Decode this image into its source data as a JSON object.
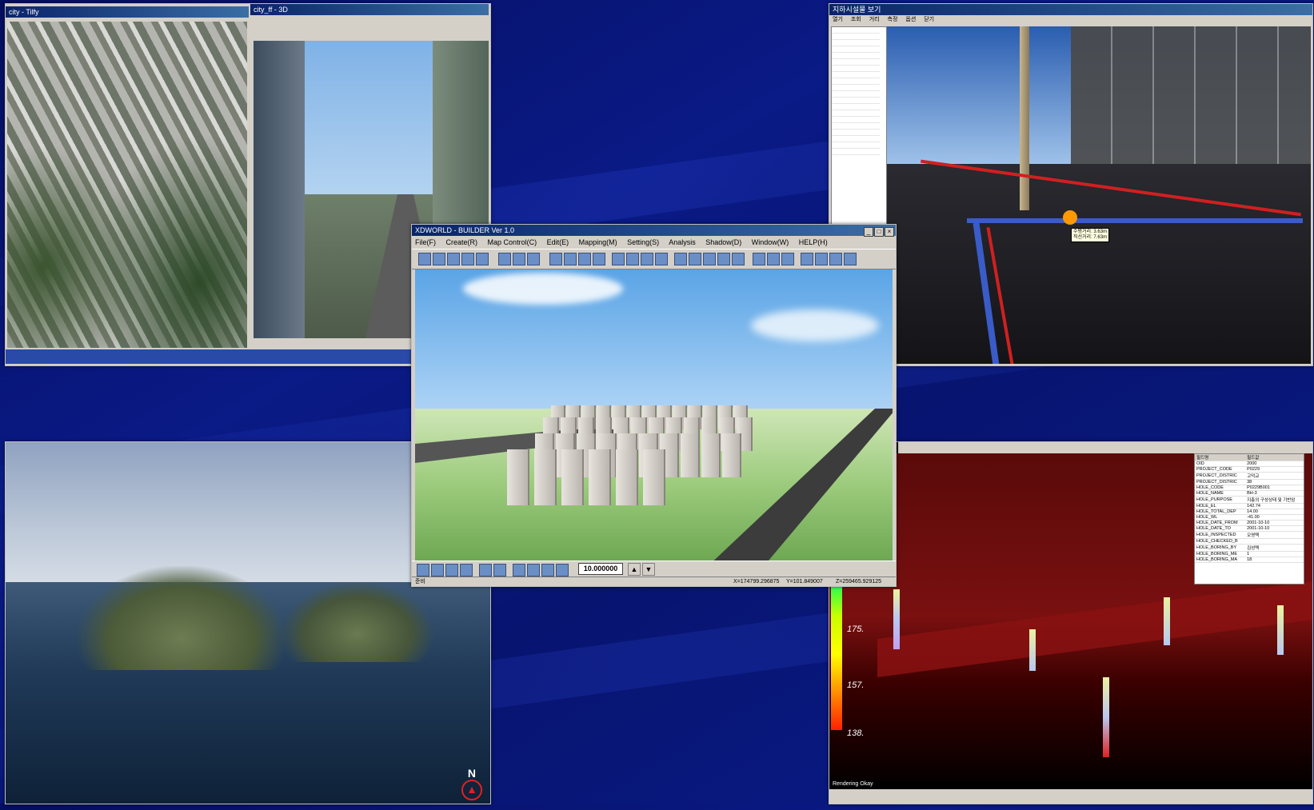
{
  "builder": {
    "title": "XDWORLD - BUILDER Ver 1.0",
    "menu": [
      "File(F)",
      "Create(R)",
      "Map Control(C)",
      "Edit(E)",
      "Mapping(M)",
      "Setting(S)",
      "Analysis",
      "Shadow(D)",
      "Window(W)",
      "HELP(H)"
    ],
    "scale_value": "10.000000",
    "status_left": "준비",
    "coord_x": "X=174799.296875",
    "coord_y": "Y=101.849007",
    "coord_z": "Z=259465.929125"
  },
  "top_left": {
    "title": "city - Tilfy",
    "title2": "city_ff - 3D"
  },
  "top_right": {
    "title": "지하시설물 보기",
    "toolbar": [
      "열기",
      "조회",
      "거리",
      "측정",
      "옵션",
      "닫기"
    ],
    "tooltip_line1": "수평거리: 3.63m",
    "tooltip_line2": "직선거리: 7.63m"
  },
  "bottom_right": {
    "legend_ticks": [
      "175.",
      "157.",
      "138."
    ],
    "status": "Rendering Okay",
    "properties": [
      [
        "필드명",
        "필드값"
      ],
      [
        "OID",
        "2000"
      ],
      [
        "PROJECT_CODE",
        "P0229"
      ],
      [
        "PROJECT_DISTRIC",
        "고덕교"
      ],
      [
        "PROJECT_DISTRIC",
        "38"
      ],
      [
        "HOLE_CODE",
        "P0229B001"
      ],
      [
        "HOLE_NAME",
        "BH-3"
      ],
      [
        "HOLE_PURPOSE",
        "지층의 구성상태 및 기반암"
      ],
      [
        "HOLE_EL",
        "142.74"
      ],
      [
        "HOLE_TOTAL_DEP",
        "14.00"
      ],
      [
        "HOLE_WL",
        "-41.00"
      ],
      [
        "HOLE_DATE_FROM",
        "2001-10-10"
      ],
      [
        "HOLE_DATE_TO",
        "2001-10-10"
      ],
      [
        "HOLE_INSPECTED",
        "오영택"
      ],
      [
        "HOLE_CHECKED_B",
        ""
      ],
      [
        "HOLE_BORING_BY",
        "김성택"
      ],
      [
        "HOLE_BORING_ME",
        "1"
      ],
      [
        "HOLE_BORING_MA",
        "18"
      ]
    ]
  },
  "bottom_left": {
    "compass": "N"
  },
  "colors": {
    "background": "#0a1a86",
    "window_chrome": "#d4d0c8",
    "title_bar": "#0a246a"
  }
}
